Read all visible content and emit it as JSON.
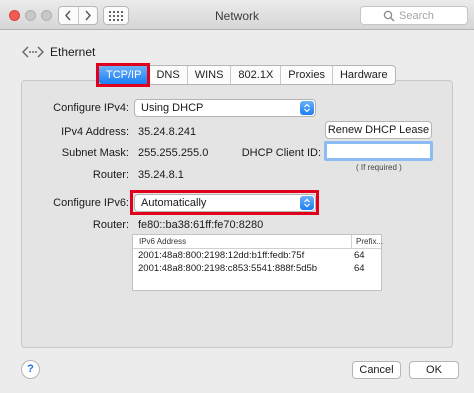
{
  "window": {
    "title": "Network"
  },
  "search": {
    "placeholder": "Search"
  },
  "breadcrumb": {
    "label": "Ethernet"
  },
  "tabs": [
    {
      "label": "TCP/IP",
      "active": true
    },
    {
      "label": "DNS"
    },
    {
      "label": "WINS"
    },
    {
      "label": "802.1X"
    },
    {
      "label": "Proxies"
    },
    {
      "label": "Hardware"
    }
  ],
  "ipv4": {
    "configure_label": "Configure IPv4:",
    "configure_value": "Using DHCP",
    "address_label": "IPv4 Address:",
    "address_value": "35.24.8.241",
    "subnet_label": "Subnet Mask:",
    "subnet_value": "255.255.255.0",
    "router_label": "Router:",
    "router_value": "35.24.8.1",
    "renew_button": "Renew DHCP Lease",
    "client_id_label": "DHCP Client ID:",
    "client_id_value": "",
    "client_id_hint": "( If required )"
  },
  "ipv6": {
    "configure_label": "Configure IPv6:",
    "configure_value": "Automatically",
    "router_label": "Router:",
    "router_value": "fe80::ba38:61ff:fe70:8280",
    "table": {
      "headers": {
        "address": "IPv6 Address",
        "prefix": "Prefix..."
      },
      "rows": [
        {
          "address": "2001:48a8:800:2198:12dd:b1ff:fedb:75f",
          "prefix": "64"
        },
        {
          "address": "2001:48a8:800:2198:c853:5541:888f:5d5b",
          "prefix": "64"
        }
      ]
    }
  },
  "footer": {
    "help": "?",
    "cancel": "Cancel",
    "ok": "OK"
  },
  "colors": {
    "highlight_red": "#e0001b",
    "accent_blue": "#1b7ef3"
  }
}
